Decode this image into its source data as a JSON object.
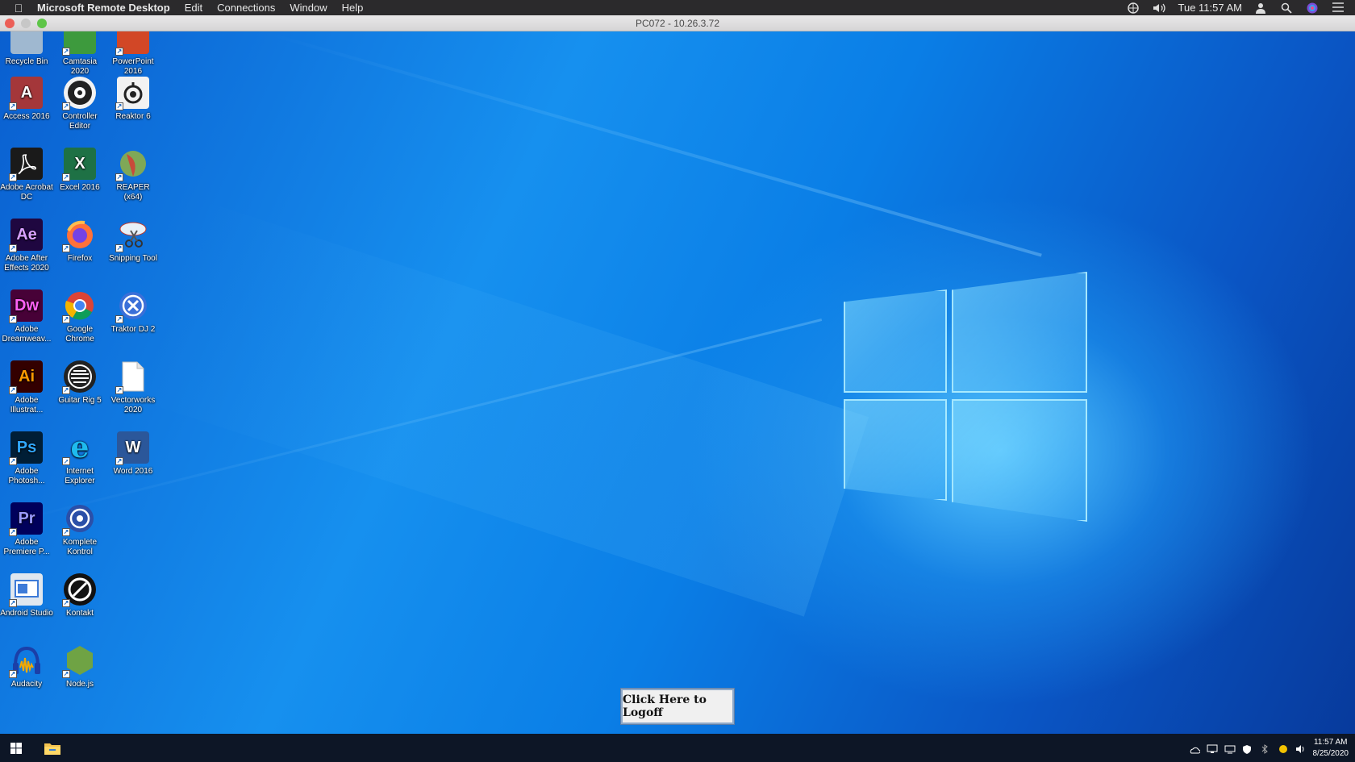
{
  "menubar": {
    "app_name": "Microsoft Remote Desktop",
    "items": [
      "Edit",
      "Connections",
      "Window",
      "Help"
    ],
    "clock": "Tue 11:57 AM"
  },
  "window": {
    "title": "PC072 - 10.26.3.72"
  },
  "desktop": {
    "icons": [
      {
        "label": "Recycle Bin",
        "icon": "recycle-bin-icon",
        "color": "#9fb8d0"
      },
      {
        "label": "Camtasia 2020",
        "icon": "camtasia-icon",
        "color": "#3d9a3d"
      },
      {
        "label": "PowerPoint 2016",
        "icon": "powerpoint-icon",
        "color": "#d24726"
      },
      {
        "label": "Access 2016",
        "icon": "access-icon",
        "color": "#a4373a"
      },
      {
        "label": "Controller Editor",
        "icon": "controller-editor-icon",
        "color": "#222222"
      },
      {
        "label": "Reaktor 6",
        "icon": "reaktor-icon",
        "color": "#f2f2f2"
      },
      {
        "label": "Adobe Acrobat DC",
        "icon": "acrobat-icon",
        "color": "#1a1a1a"
      },
      {
        "label": "Excel 2016",
        "icon": "excel-icon",
        "color": "#1e7145"
      },
      {
        "label": "REAPER (x64)",
        "icon": "reaper-icon",
        "color": "#7fa857"
      },
      {
        "label": "Adobe After Effects 2020",
        "icon": "after-effects-icon",
        "color": "#1f0740"
      },
      {
        "label": "Firefox",
        "icon": "firefox-icon",
        "color": "#ff7139"
      },
      {
        "label": "Snipping Tool",
        "icon": "snipping-tool-icon",
        "color": "#e8f0f8"
      },
      {
        "label": "Adobe Dreamweav...",
        "icon": "dreamweaver-icon",
        "color": "#470137"
      },
      {
        "label": "Google Chrome",
        "icon": "chrome-icon",
        "color": "#4285f4"
      },
      {
        "label": "Traktor DJ 2",
        "icon": "traktor-icon",
        "color": "#3a6fd8"
      },
      {
        "label": "Adobe Illustrat...",
        "icon": "illustrator-icon",
        "color": "#330000"
      },
      {
        "label": "Guitar Rig 5",
        "icon": "guitar-rig-icon",
        "color": "#222222"
      },
      {
        "label": "Vectorworks 2020",
        "icon": "file-icon",
        "color": "#ffffff"
      },
      {
        "label": "Adobe Photosh...",
        "icon": "photoshop-icon",
        "color": "#001e36"
      },
      {
        "label": "Internet Explorer",
        "icon": "internet-explorer-icon",
        "color": "#1ebbee"
      },
      {
        "label": "Word 2016",
        "icon": "word-icon",
        "color": "#2b579a"
      },
      {
        "label": "Adobe Premiere P...",
        "icon": "premiere-icon",
        "color": "#00005b"
      },
      {
        "label": "Komplete Kontrol",
        "icon": "komplete-kontrol-icon",
        "color": "#2b4fa8"
      },
      {
        "label": "Android Studio",
        "icon": "android-studio-icon",
        "color": "#3d7bd8"
      },
      {
        "label": "Kontakt",
        "icon": "kontakt-icon",
        "color": "#111111"
      },
      {
        "label": "Audacity",
        "icon": "audacity-icon",
        "color": "#1b3fa8"
      },
      {
        "label": "Node.js",
        "icon": "nodejs-icon",
        "color": "#6fa344"
      }
    ],
    "glyphs": {
      "access": "A",
      "excel": "X",
      "ae": "Ae",
      "dw": "Dw",
      "ai": "Ai",
      "ps": "Ps",
      "pr": "Pr",
      "word": "W",
      "ie": "e"
    }
  },
  "logoff_button": "Click Here to Logoff",
  "taskbar": {
    "time": "11:57 AM",
    "date": "8/25/2020"
  }
}
